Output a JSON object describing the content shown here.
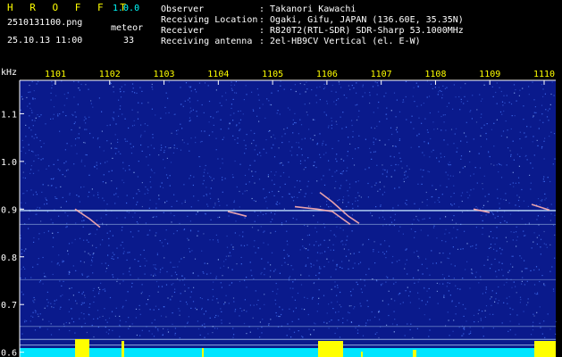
{
  "app": {
    "name": "H R O F F T",
    "version": "1.0.0",
    "file_name": "2510131100.png",
    "datetime": "25.10.13 11:00",
    "meteor_label": "meteor",
    "meteor_count": "33"
  },
  "info": {
    "rows": [
      {
        "label": "Observer",
        "value": ": Takanori Kawachi"
      },
      {
        "label": "Receiving Location",
        "value": ": Ogaki, Gifu, JAPAN (136.60E, 35.35N)"
      },
      {
        "label": "Receiver",
        "value": ": R820T2(RTL-SDR) SDR-Sharp 53.1000MHz"
      },
      {
        "label": "Receiving antenna",
        "value": ": 2el-HB9CV Vertical (el. E-W)"
      }
    ]
  },
  "chart_data": {
    "type": "heatmap",
    "ylabel": "kHz",
    "x_tick_labels": [
      "1101",
      "1102",
      "1103",
      "1104",
      "1105",
      "1106",
      "1107",
      "1108",
      "1109",
      "1110"
    ],
    "y_tick_labels": [
      "1.1",
      "1.0",
      "0.9",
      "0.8",
      "0.7",
      "0.6"
    ],
    "y_ticks": [
      1.1,
      1.0,
      0.9,
      0.8,
      0.7,
      0.6
    ],
    "ylim": [
      0.59,
      1.17
    ],
    "colors": {
      "background": "#0a1a8c",
      "noise": "#4a7cff",
      "carrier": "#c8e8ff",
      "meteor": "#ffb0b0",
      "level": "#00e5ff",
      "peak": "#ffff00"
    }
  }
}
